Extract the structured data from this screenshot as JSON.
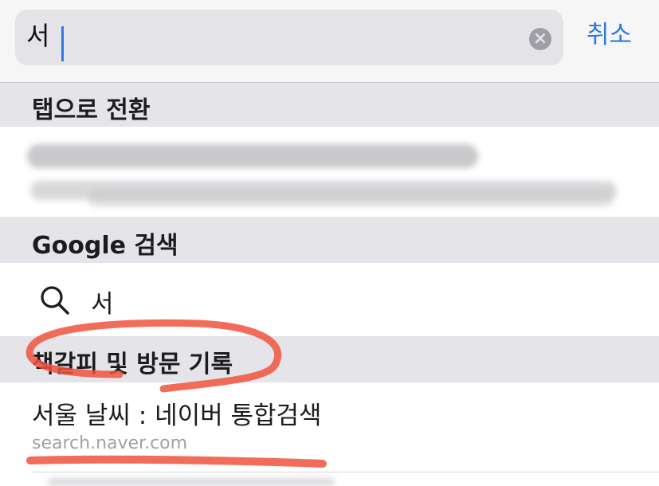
{
  "search": {
    "value": "서",
    "clear_icon": "clear-icon"
  },
  "cancel_label": "취소",
  "sections": {
    "switch_to_tab": {
      "title": "탭으로 전환"
    },
    "google_search": {
      "title": "Google 검색",
      "query": "서",
      "icon": "search-icon"
    },
    "bookmarks_history": {
      "title": "책갈피 및 방문 기록"
    }
  },
  "history_item": {
    "title": "서울 날씨 : 네이버 통합검색",
    "url": "search.naver.com"
  },
  "colors": {
    "accent": "#2d7ae2",
    "annotation": "#f0533c"
  }
}
